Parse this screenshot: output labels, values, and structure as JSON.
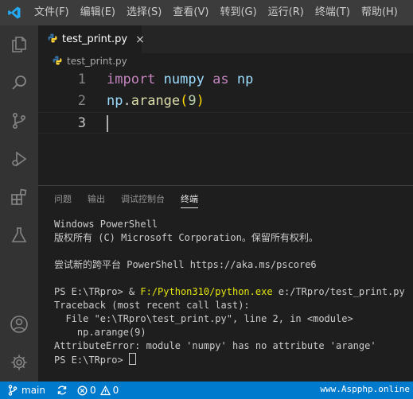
{
  "menu": [
    "文件(F)",
    "编辑(E)",
    "选择(S)",
    "查看(V)",
    "转到(G)",
    "运行(R)",
    "终端(T)",
    "帮助(H)"
  ],
  "tab": {
    "filename": "test_print.py",
    "close": "×"
  },
  "breadcrumb": "test_print.py",
  "editor": {
    "lines": [
      {
        "num": "1",
        "tokens": [
          {
            "t": "import",
            "c": "kw"
          },
          {
            "t": " ",
            "c": "pl"
          },
          {
            "t": "numpy",
            "c": "id"
          },
          {
            "t": " ",
            "c": "pl"
          },
          {
            "t": "as",
            "c": "kw"
          },
          {
            "t": " ",
            "c": "pl"
          },
          {
            "t": "np",
            "c": "id"
          }
        ]
      },
      {
        "num": "2",
        "tokens": [
          {
            "t": "np",
            "c": "id"
          },
          {
            "t": ".",
            "c": "pl"
          },
          {
            "t": "arange",
            "c": "fn"
          },
          {
            "t": "(",
            "c": "br"
          },
          {
            "t": "9",
            "c": "nm"
          },
          {
            "t": ")",
            "c": "br"
          }
        ]
      },
      {
        "num": "3",
        "tokens": []
      }
    ]
  },
  "panel": {
    "tabs": [
      "问题",
      "输出",
      "调试控制台",
      "终端"
    ],
    "active_tab": "终端",
    "terminal": {
      "l1": "Windows PowerShell",
      "l2": "版权所有 (C) Microsoft Corporation。保留所有权利。",
      "l3": "尝试新的跨平台 PowerShell https://aka.ms/pscore6",
      "l4_prompt": "PS E:\\TRpro> & ",
      "l4_exe": "F:/Python310/python.exe",
      "l4_arg": " e:/TRpro/test_print.py",
      "l5": "Traceback (most recent call last):",
      "l6": "  File \"e:\\TRpro\\test_print.py\", line 2, in <module>",
      "l7": "    np.arange(9)",
      "l8": "AttributeError: module 'numpy' has no attribute 'arange'",
      "l9": "PS E:\\TRpro> "
    }
  },
  "status": {
    "branch": "main",
    "errors": "0",
    "warnings": "0"
  },
  "watermark": "www.Aspphp.online",
  "colors": {
    "accent": "#007acc",
    "python_yellow": "#ffd43b",
    "python_blue": "#3572a5"
  }
}
